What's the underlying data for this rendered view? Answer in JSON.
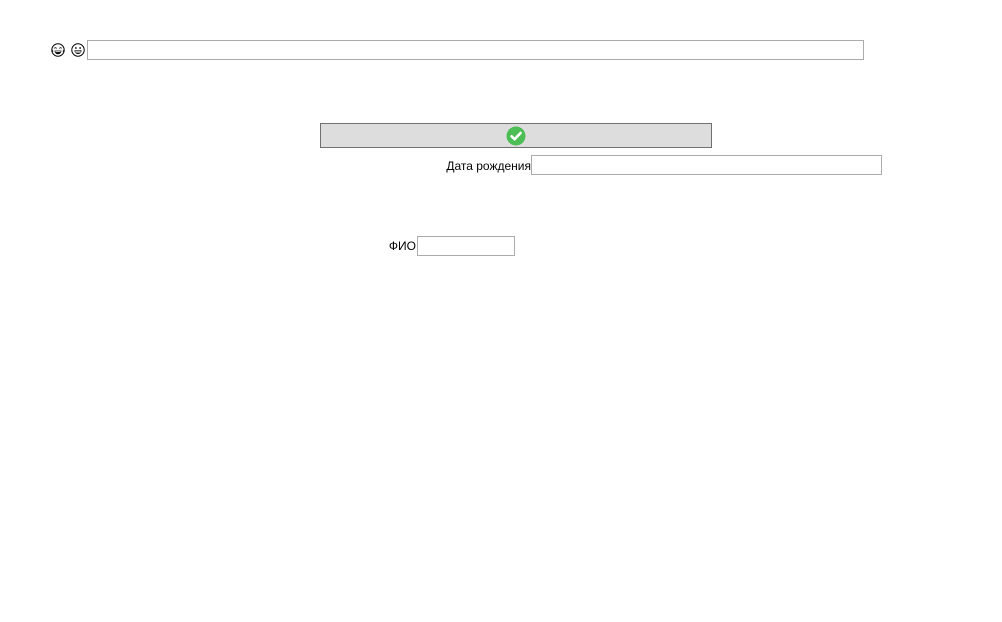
{
  "toolbar": {
    "icons": [
      {
        "name": "laughing-face-emoji-icon",
        "glyph": "😂"
      },
      {
        "name": "grinning-face-emoji-icon",
        "glyph": "😁"
      }
    ],
    "text_input": {
      "value": "",
      "placeholder": ""
    }
  },
  "confirm_button": {
    "icon": "check-circle-icon",
    "icon_color": "#4dbd55",
    "background": "#dddddd"
  },
  "form": {
    "birth_date": {
      "label": "Дата рождения",
      "value": ""
    },
    "full_name": {
      "label": "ФИО",
      "value": ""
    }
  }
}
